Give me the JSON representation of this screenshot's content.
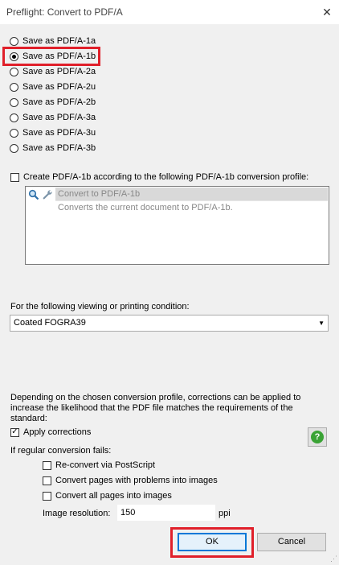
{
  "window": {
    "title": "Preflight: Convert to PDF/A",
    "close_glyph": "✕"
  },
  "save_options": [
    {
      "label": "Save as PDF/A-1a",
      "checked": false
    },
    {
      "label": "Save as PDF/A-1b",
      "checked": true
    },
    {
      "label": "Save as PDF/A-2a",
      "checked": false
    },
    {
      "label": "Save as PDF/A-2u",
      "checked": false
    },
    {
      "label": "Save as PDF/A-2b",
      "checked": false
    },
    {
      "label": "Save as PDF/A-3a",
      "checked": false
    },
    {
      "label": "Save as PDF/A-3u",
      "checked": false
    },
    {
      "label": "Save as PDF/A-3b",
      "checked": false
    }
  ],
  "profile": {
    "checkbox_label": "Create PDF/A-1b according to the following PDF/A-1b conversion profile:",
    "checked": false,
    "name": "Convert to PDF/A-1b",
    "description": "Converts the current document to PDF/A-1b.",
    "icons": [
      "magnifier-icon",
      "wrench-icon"
    ]
  },
  "condition": {
    "label": "For the following viewing or printing condition:",
    "selected": "Coated FOGRA39"
  },
  "corrections": {
    "info": "Depending on the chosen conversion profile, corrections can be applied to increase the likelihood that the PDF file matches the requirements of the standard:",
    "apply_label": "Apply corrections",
    "apply_checked": true,
    "help_glyph": "?"
  },
  "fallback": {
    "label": "If regular conversion fails:",
    "reconvert_label": "Re-convert via PostScript",
    "convert_problem_pages_label": "Convert pages with problems into images",
    "convert_all_pages_label": "Convert all pages into images",
    "resolution_label": "Image resolution:",
    "resolution_value": "150",
    "resolution_unit": "ppi"
  },
  "buttons": {
    "ok": "OK",
    "cancel": "Cancel"
  },
  "colors": {
    "highlight": "#e0202a",
    "default_button_border": "#0078d7",
    "help_green": "#3aa335"
  }
}
